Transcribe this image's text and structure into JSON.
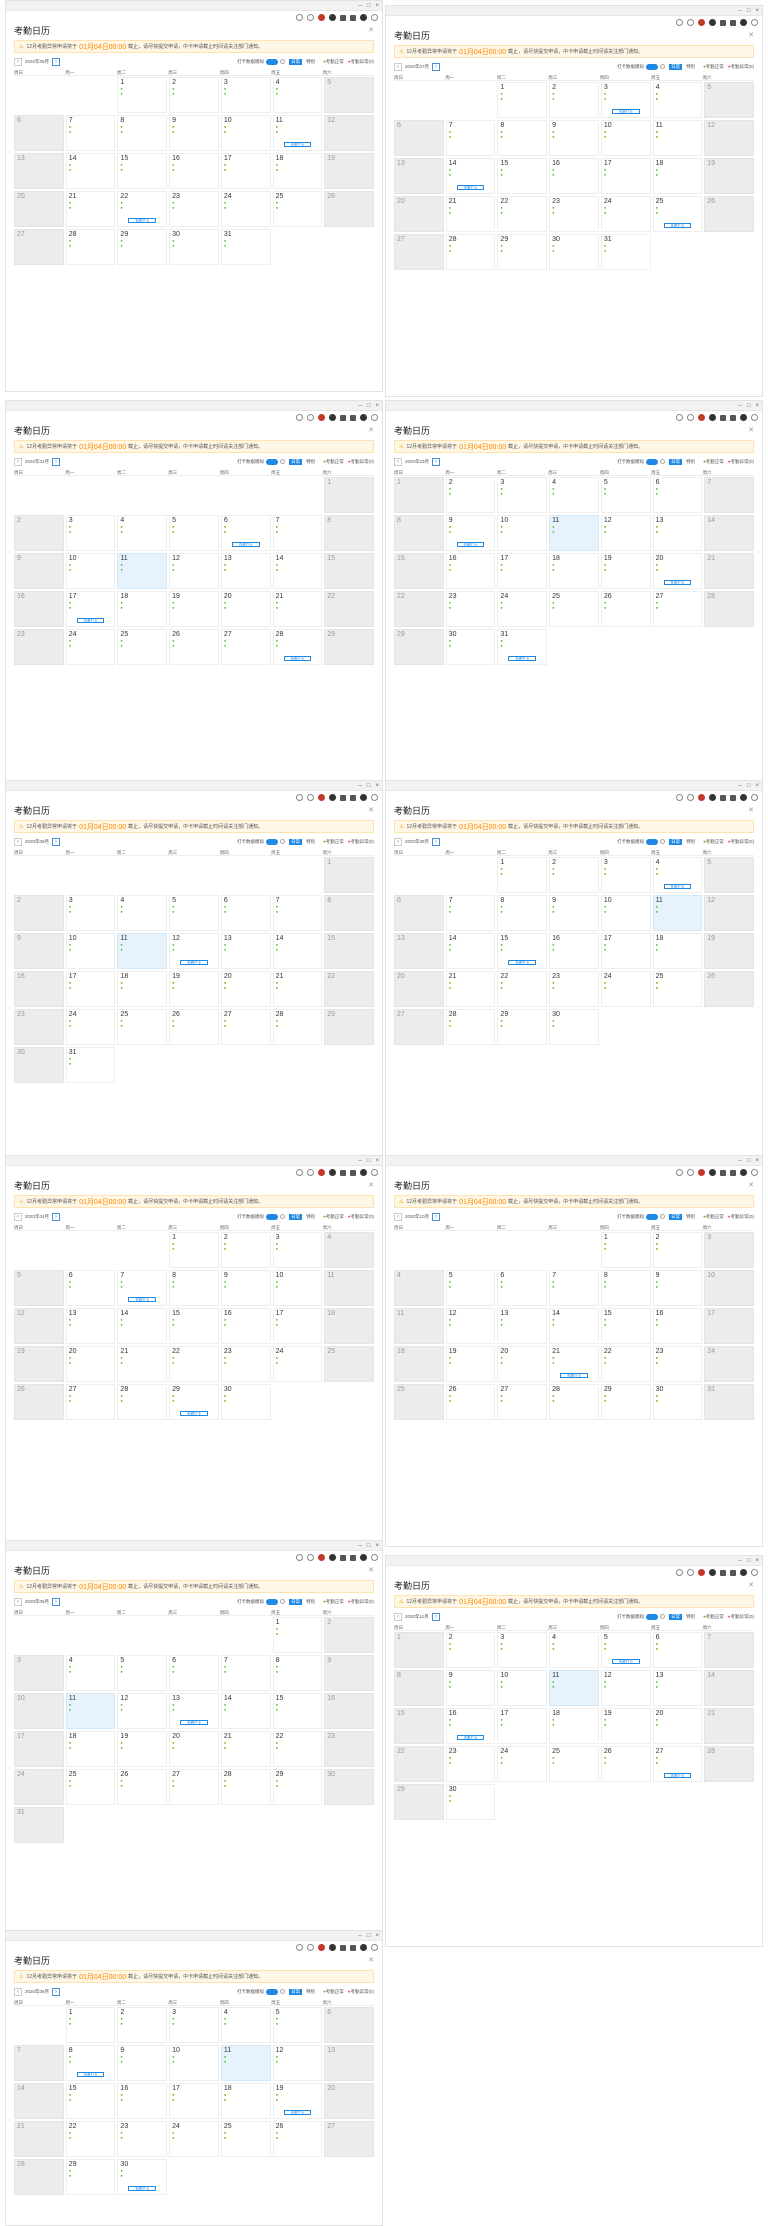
{
  "app_title": "考勤日历",
  "notice": {
    "icon": "warning-icon",
    "prefix": "12月考勤异常申请将于",
    "deadline": "01月04日00:00",
    "suffix": "截止，请尽快提交申请，中卡申请截止时间请关注部门通知。"
  },
  "controls": {
    "toggle_label": "打卡数据模拟",
    "mode_normal": "日常",
    "mode_special": "特别",
    "legend_present": "考勤正常",
    "legend_absent": "考勤异常",
    "legend_count": "(0)"
  },
  "weekdays": [
    "周日",
    "周一",
    "周二",
    "周三",
    "周四",
    "周五",
    "周六"
  ],
  "button_label": "查看打卡",
  "months": [
    {
      "month_label": "2020年05月",
      "lead": 2,
      "days": 31,
      "today": 0
    },
    {
      "month_label": "2020年07月",
      "lead": 2,
      "days": 31,
      "today": 0
    },
    {
      "month_label": "2020年02月",
      "lead": 6,
      "days": 29,
      "today": 11
    },
    {
      "month_label": "2020年03月",
      "lead": 0,
      "days": 31,
      "today": 11
    },
    {
      "month_label": "2020年08月",
      "lead": 6,
      "days": 31,
      "today": 11
    },
    {
      "month_label": "2020年09月",
      "lead": 2,
      "days": 30,
      "today": 11
    },
    {
      "month_label": "2020年04月",
      "lead": 3,
      "days": 30,
      "today": 0
    },
    {
      "month_label": "2020年10月",
      "lead": 4,
      "days": 31,
      "today": 0
    },
    {
      "month_label": "2020年05月",
      "lead": 5,
      "days": 31,
      "today": 11
    },
    {
      "month_label": "2020年11月",
      "lead": 0,
      "days": 30,
      "today": 11
    },
    {
      "month_label": "2020年06月",
      "lead": 1,
      "days": 30,
      "today": 11
    }
  ]
}
